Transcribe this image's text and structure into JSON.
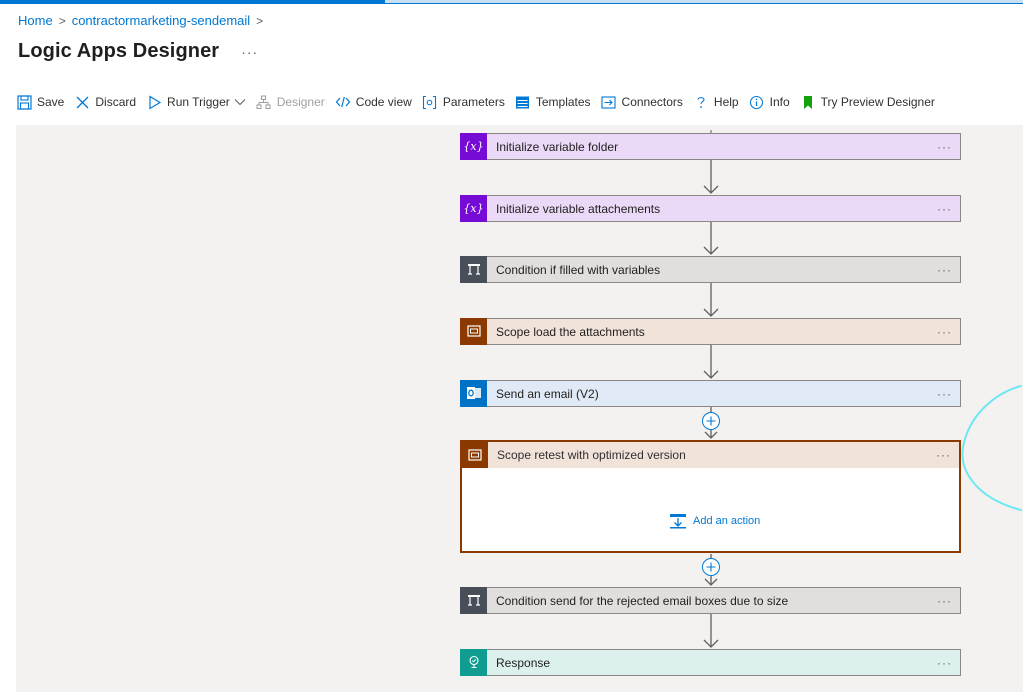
{
  "breadcrumb": {
    "home": "Home",
    "sep": ">",
    "resource": "contractormarketing-sendemail"
  },
  "page": {
    "title": "Logic Apps Designer",
    "more": "···"
  },
  "toolbar": {
    "save": "Save",
    "discard": "Discard",
    "run_trigger": "Run Trigger",
    "designer": "Designer",
    "code_view": "Code view",
    "parameters": "Parameters",
    "templates": "Templates",
    "connectors": "Connectors",
    "help": "Help",
    "info": "Info",
    "try_preview": "Try Preview Designer"
  },
  "steps": [
    {
      "label": "Initialize variable folder",
      "kind": "variable",
      "badge": "{x}",
      "more": "···"
    },
    {
      "label": "Initialize variable attachements",
      "kind": "variable",
      "badge": "{x}",
      "more": "···"
    },
    {
      "label": "Condition if filled with variables",
      "kind": "condition",
      "more": "···"
    },
    {
      "label": "Scope load the attachments",
      "kind": "scope",
      "more": "···"
    },
    {
      "label": "Send an email (V2)",
      "kind": "outlook",
      "more": "···"
    },
    {
      "label": "Scope retest with optimized version",
      "kind": "scope",
      "more": "···",
      "expanded": true,
      "add_action": "Add an action"
    },
    {
      "label": "Condition send for the rejected email boxes due to size",
      "kind": "condition",
      "more": "···"
    },
    {
      "label": "Response",
      "kind": "response",
      "more": "···"
    }
  ],
  "colors": {
    "accent": "#0078d4",
    "variable": "#770bd6",
    "condition": "#484f58",
    "scope": "#8c3900",
    "outlook": "#0072c6",
    "response": "#0f9d91",
    "annotation": "#6ee8f0"
  }
}
